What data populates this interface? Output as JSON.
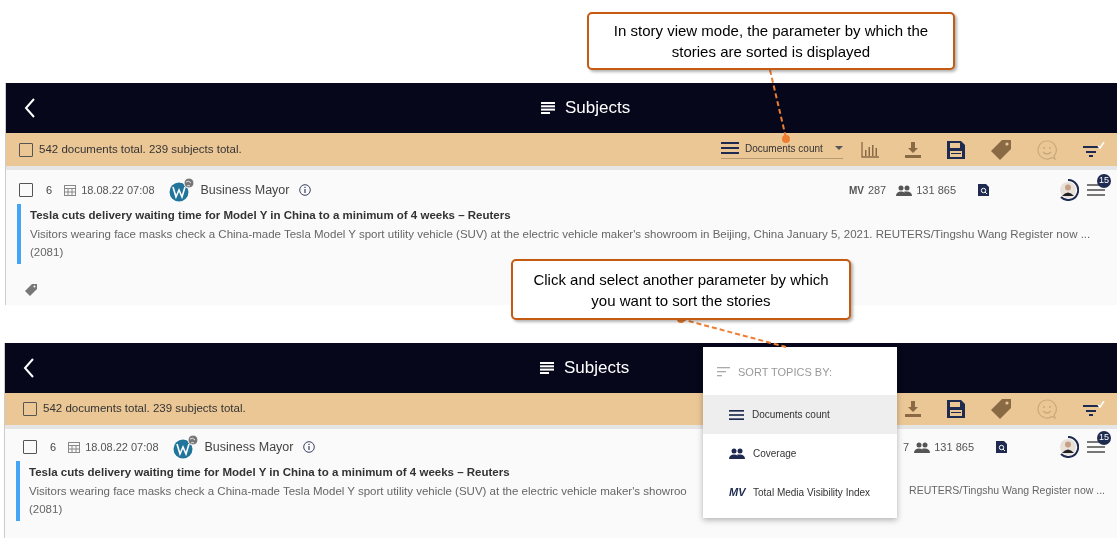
{
  "callouts": [
    {
      "text": "In story view mode, the parameter by which the stories are sorted is displayed"
    },
    {
      "text": "Click and select another parameter by which you want to sort the stories"
    }
  ],
  "panel_1": {
    "header": {
      "title": "Subjects"
    },
    "toolbar": {
      "checked": false,
      "summary": "542 documents total. 239 subjects total.",
      "sort": {
        "label": "Documents count"
      }
    },
    "story": {
      "checked": false,
      "count": "6",
      "date": "18.08.22 07:08",
      "source": "Business Mayor",
      "mv_label": "MV",
      "mv": "287",
      "coverage": "131 865",
      "badge": "15",
      "title": "Tesla cuts delivery waiting time for Model Y in China to a minimum of 4 weeks – Reuters",
      "description": "Visitors wearing face masks check a China-made Tesla Model Y sport utility vehicle (SUV) at the electric vehicle maker's showroom in Beijing, China January 5, 2021. REUTERS/Tingshu Wang Register now ...",
      "description_line_2": "(2081)"
    }
  },
  "panel_2": {
    "header": {
      "title": "Subjects"
    },
    "toolbar": {
      "checked": false,
      "summary": "542 documents total. 239 subjects total."
    },
    "story": {
      "checked": false,
      "count": "6",
      "date": "18.08.22 07:08",
      "source": "Business Mayor",
      "mv_tail": "7",
      "coverage": "131 865",
      "badge": "15",
      "title": "Tesla cuts delivery waiting time for Model Y in China to a minimum of 4 weeks – Reuters",
      "description_left": "Visitors wearing face masks check a China-made Tesla Model Y sport utility vehicle (SUV) at the electric vehicle maker's showroo",
      "description_right": "REUTERS/Tingshu Wang Register now ...",
      "description_line_2": "(2081)"
    },
    "sort_menu": {
      "heading": "SORT TOPICS BY:",
      "items": [
        {
          "kind": "lines",
          "label": "Documents count",
          "selected": true
        },
        {
          "kind": "people",
          "label": "Coverage",
          "selected": false
        },
        {
          "kind": "text",
          "mark": "MV",
          "label": "Total Media Visibility Index",
          "selected": false
        }
      ]
    }
  }
}
